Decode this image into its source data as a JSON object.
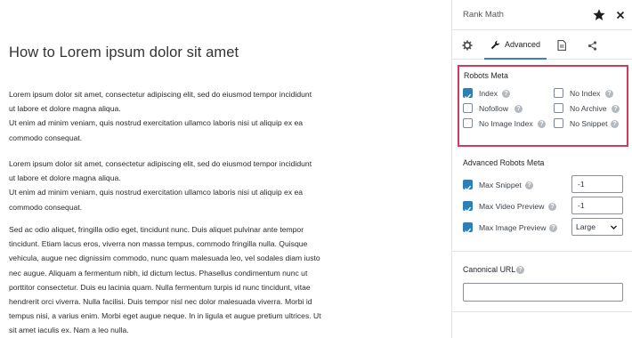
{
  "editor": {
    "title": "How to Lorem ipsum dolor sit amet",
    "paragraphs": [
      [
        "Lorem ipsum dolor sit amet, consectetur adipiscing elit, sed do eiusmod tempor incididunt",
        "ut labore et dolore magna aliqua.",
        "Ut enim ad minim veniam, quis nostrud exercitation ullamco laboris nisi ut aliquip ex ea",
        "commodo consequat."
      ],
      [
        " Lorem ipsum dolor sit amet, consectetur adipiscing elit, sed do eiusmod tempor incididunt",
        "ut labore et dolore magna aliqua.",
        "Ut enim ad minim veniam, quis nostrud exercitation ullamco laboris nisi ut aliquip ex ea",
        "commodo consequat."
      ],
      [
        "Sed ac odio aliquet, fringilla odio eget, tincidunt nunc. Duis aliquet pulvinar ante tempor",
        "tincidunt. Etiam lacus eros, viverra non massa tempus, commodo fringilla nulla. Quisque",
        "vehicula, augue nec dignissim commodo, nunc quam malesuada leo, vel sodales diam iusto",
        "nec augue. Aliquam a fermentum nibh, id dictum lectus. Phasellus condimentum nunc ut",
        "porttitor consectetur. Duis eu lacinia quam. Nulla fermentum turpis id nunc tincidunt, vitae",
        "hendrerit orci viverra. Nulla facilisi. Duis tempor nisl nec dolor malesuada viverra. Morbi id",
        "tempus nisi, a varius enim. Morbi eget augue neque. In in ligula et augue pretium ultrices. Ut",
        "sit amet iaculis ex. Nam a leo nulla."
      ]
    ]
  },
  "sidebar": {
    "title": "Rank Math",
    "tabs": {
      "advanced": "Advanced"
    },
    "robots_meta": {
      "title": "Robots Meta",
      "options": [
        {
          "label": "Index",
          "checked": true
        },
        {
          "label": "No Index",
          "checked": false
        },
        {
          "label": "Nofollow",
          "checked": false
        },
        {
          "label": "No Archive",
          "checked": false
        },
        {
          "label": "No Image Index",
          "checked": false
        },
        {
          "label": "No Snippet",
          "checked": false
        }
      ]
    },
    "advanced_robots": {
      "title": "Advanced Robots Meta",
      "rows": [
        {
          "label": "Max Snippet",
          "checked": true,
          "value": "-1"
        },
        {
          "label": "Max Video Preview",
          "checked": true,
          "value": "-1"
        },
        {
          "label": "Max Image Preview",
          "checked": true,
          "value": "Large"
        }
      ]
    },
    "canonical": {
      "title": "Canonical URL",
      "value": ""
    },
    "colors": {
      "accent": "#2e7fb6",
      "highlight_border": "#d23a5e",
      "tab_underline": "#3b7ecb"
    }
  }
}
